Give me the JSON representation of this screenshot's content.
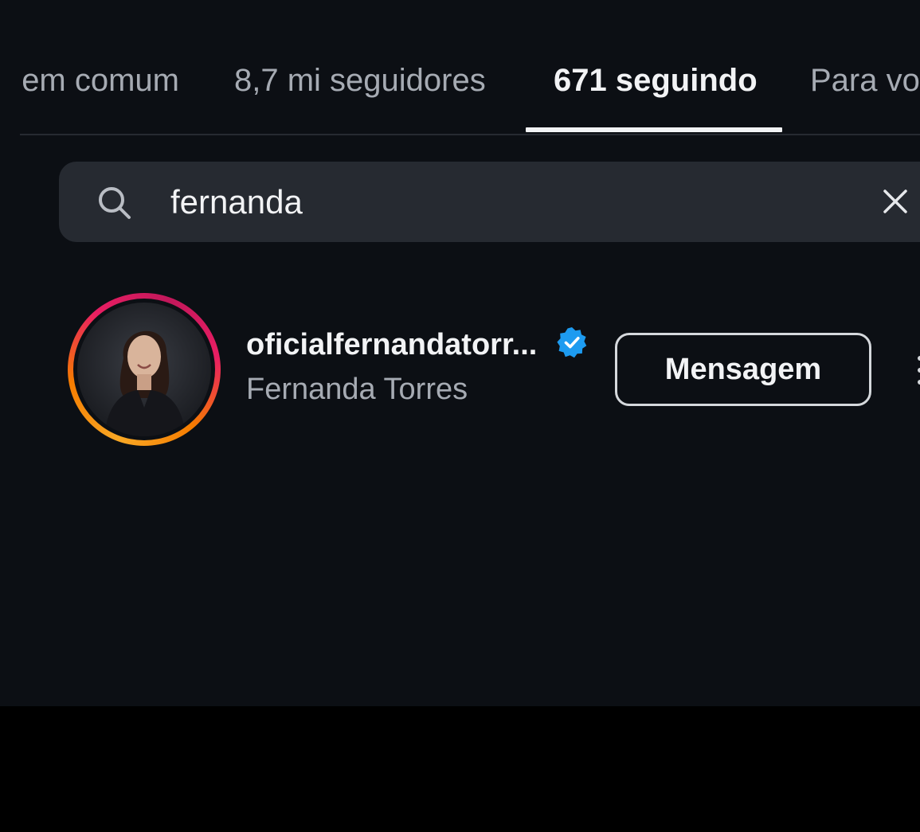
{
  "tabs": {
    "mutual_label": "em comum",
    "followers_label": "8,7 mi seguidores",
    "following_label": "671 seguindo",
    "for_you_label": "Para vo"
  },
  "search": {
    "query": "fernanda",
    "icon": "search-icon",
    "clear_icon": "close-icon"
  },
  "result": {
    "username": "oficialfernandatorr...",
    "full_name": "Fernanda Torres",
    "verified": true,
    "verified_color": "#1d9bf0",
    "button_label": "Mensagem",
    "has_story_ring": true
  },
  "colors": {
    "background": "#0c0f14",
    "search_bg": "#262a31",
    "text_primary": "#f2f3f5",
    "text_secondary": "#a6abb3"
  }
}
